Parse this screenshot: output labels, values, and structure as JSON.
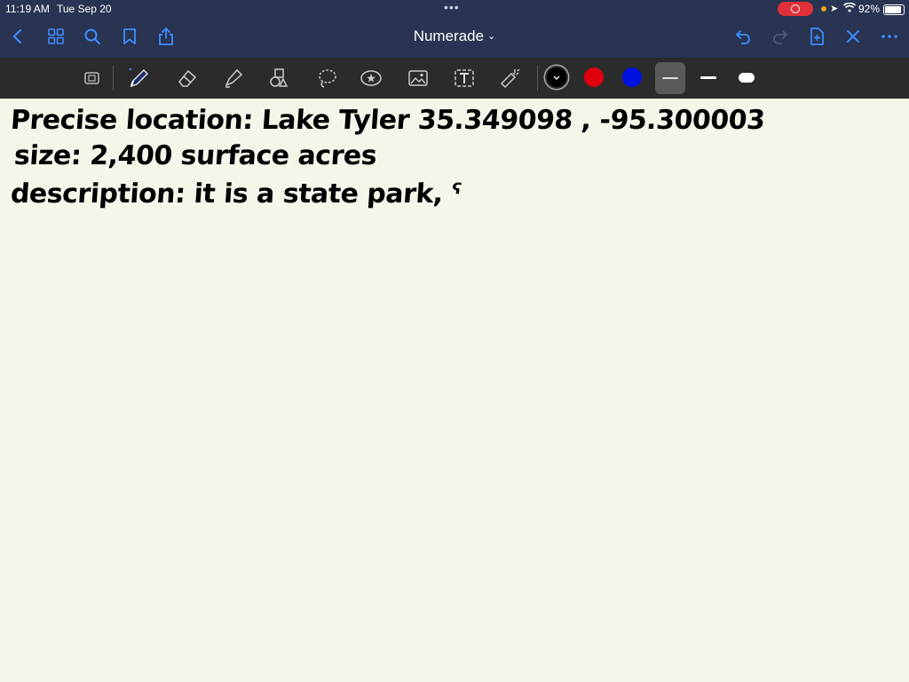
{
  "status": {
    "time": "11:19 AM",
    "date": "Tue Sep 20",
    "battery_pct": "92%",
    "battery_level": 0.92
  },
  "nav": {
    "title": "Numerade",
    "chevron": "⌄"
  },
  "toolbar": {
    "colors": [
      "#000000",
      "#e0000d",
      "#0010e0"
    ],
    "selected_color_index": 0
  },
  "note": {
    "line1": "Precise location: Lake Tyler  35.349098 , -95.300003",
    "line2": "size: 2,400 surface acres",
    "line3": "description: it is a state park, ˁ"
  }
}
